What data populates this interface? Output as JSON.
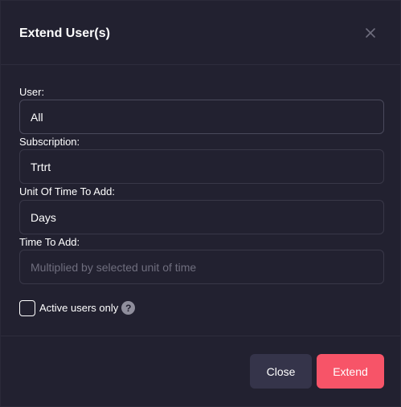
{
  "modal": {
    "title": "Extend User(s)",
    "close_icon": "close-icon"
  },
  "form": {
    "user": {
      "label": "User:",
      "value": "All"
    },
    "subscription": {
      "label": "Subscription:",
      "value": "Trtrt"
    },
    "unit_of_time": {
      "label": "Unit Of Time To Add:",
      "value": "Days"
    },
    "time_to_add": {
      "label": "Time To Add:",
      "value": "",
      "placeholder": "Multiplied by selected unit of time"
    },
    "active_users_only": {
      "label": "Active users only",
      "checked": false,
      "help_icon": "question-circle-icon"
    }
  },
  "footer": {
    "close_label": "Close",
    "extend_label": "Extend"
  },
  "colors": {
    "background": "#222130",
    "accent": "#f75468",
    "secondary_button": "#35344a",
    "border": "#393848"
  }
}
